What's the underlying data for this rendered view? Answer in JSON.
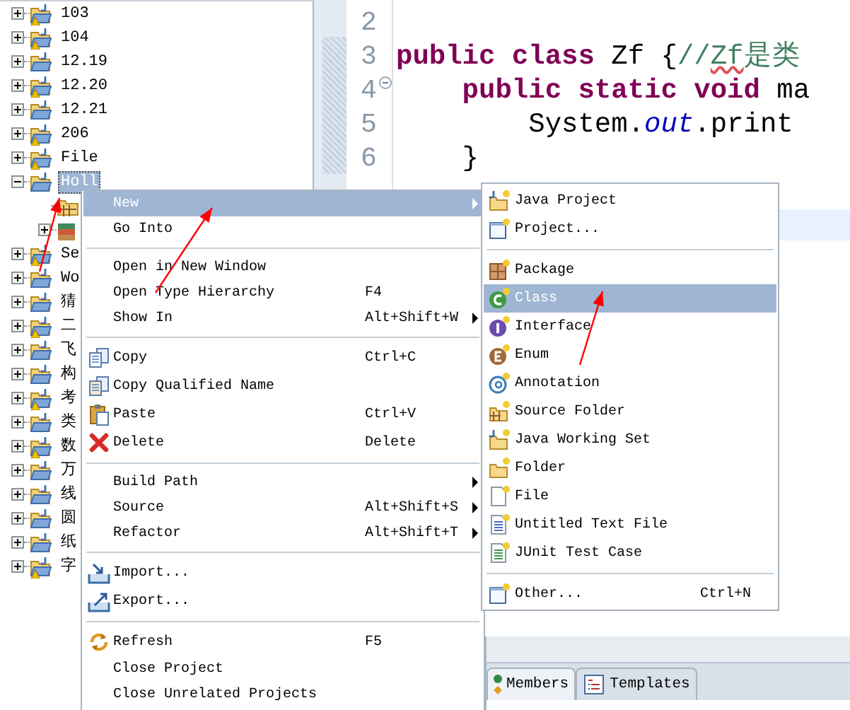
{
  "tree": [
    {
      "label": "103",
      "warning": true,
      "expanded": false,
      "selected": false
    },
    {
      "label": "104",
      "warning": true,
      "expanded": false,
      "selected": false
    },
    {
      "label": "12.19",
      "warning": false,
      "expanded": false,
      "selected": false
    },
    {
      "label": "12.20",
      "warning": true,
      "expanded": false,
      "selected": false
    },
    {
      "label": "12.21",
      "warning": false,
      "expanded": false,
      "selected": false
    },
    {
      "label": "206",
      "warning": true,
      "expanded": false,
      "selected": false
    },
    {
      "label": "File",
      "warning": true,
      "expanded": false,
      "selected": false
    },
    {
      "label": "Holl",
      "warning": false,
      "expanded": true,
      "selected": true,
      "children": [
        {
          "kind": "source-folder"
        },
        {
          "kind": "library",
          "expanded": false
        }
      ]
    },
    {
      "label": "Se",
      "warning": true,
      "expanded": false,
      "selected": false
    },
    {
      "label": "Wo",
      "warning": false,
      "expanded": false,
      "selected": false
    },
    {
      "label": "猜",
      "warning": false,
      "expanded": false,
      "selected": false
    },
    {
      "label": "二",
      "warning": true,
      "expanded": false,
      "selected": false
    },
    {
      "label": "飞",
      "warning": false,
      "expanded": false,
      "selected": false
    },
    {
      "label": "构",
      "warning": false,
      "expanded": false,
      "selected": false
    },
    {
      "label": "考",
      "warning": true,
      "expanded": false,
      "selected": false
    },
    {
      "label": "类",
      "warning": false,
      "expanded": false,
      "selected": false
    },
    {
      "label": "数",
      "warning": true,
      "expanded": false,
      "selected": false
    },
    {
      "label": "万",
      "warning": false,
      "expanded": false,
      "selected": false
    },
    {
      "label": "线",
      "warning": false,
      "expanded": false,
      "selected": false
    },
    {
      "label": "圆",
      "warning": false,
      "expanded": false,
      "selected": false
    },
    {
      "label": "纸",
      "warning": false,
      "expanded": false,
      "selected": false
    },
    {
      "label": "字",
      "warning": true,
      "expanded": false,
      "selected": false
    }
  ],
  "editor": {
    "lines": [
      {
        "number": "2",
        "fold": false
      },
      {
        "number": "3",
        "fold": false,
        "tokens": [
          {
            "kind": "keyword",
            "text": "public class"
          },
          {
            "kind": "plain",
            "text": " Zf {"
          },
          {
            "kind": "comment",
            "text": "//"
          },
          {
            "kind": "misspelled",
            "text": "Zf"
          },
          {
            "kind": "comment",
            "text": "是类"
          }
        ]
      },
      {
        "number": "4",
        "fold": true,
        "tokens": [
          {
            "kind": "keyword",
            "text": "    public static void"
          },
          {
            "kind": "plain",
            "text": " ma"
          }
        ]
      },
      {
        "number": "5",
        "fold": false,
        "tokens": [
          {
            "kind": "plain",
            "text": "        System."
          },
          {
            "kind": "field",
            "text": "out"
          },
          {
            "kind": "plain",
            "text": ".print"
          }
        ]
      },
      {
        "number": "6",
        "fold": false,
        "tokens": [
          {
            "kind": "plain",
            "text": "    }"
          }
        ]
      }
    ]
  },
  "context_menu": {
    "groups": [
      [
        {
          "label": "New",
          "submenu": true,
          "selected": true
        },
        {
          "label": "Go Into",
          "submenu": false,
          "selected": false
        }
      ],
      [
        {
          "label": "Open in New Window",
          "submenu": false,
          "selected": false
        },
        {
          "label": "Open Type Hierarchy",
          "shortcut": "F4",
          "submenu": false,
          "selected": false
        },
        {
          "label": "Show In",
          "shortcut": "Alt+Shift+W",
          "submenu": true,
          "selected": false
        }
      ],
      [
        {
          "kind": "copy",
          "label": "Copy",
          "shortcut": "Ctrl+C",
          "submenu": false,
          "selected": false
        },
        {
          "kind": "copy-qualified",
          "label": "Copy Qualified Name",
          "submenu": false,
          "selected": false
        },
        {
          "kind": "paste",
          "label": "Paste",
          "shortcut": "Ctrl+V",
          "submenu": false,
          "selected": false
        },
        {
          "kind": "delete",
          "label": "Delete",
          "shortcut": "Delete",
          "submenu": false,
          "selected": false
        }
      ],
      [
        {
          "label": "Build Path",
          "submenu": true,
          "selected": false
        },
        {
          "label": "Source",
          "shortcut": "Alt+Shift+S",
          "submenu": true,
          "selected": false
        },
        {
          "label": "Refactor",
          "shortcut": "Alt+Shift+T",
          "submenu": true,
          "selected": false
        }
      ],
      [
        {
          "kind": "import",
          "label": "Import...",
          "submenu": false,
          "selected": false
        },
        {
          "kind": "export",
          "label": "Export...",
          "submenu": false,
          "selected": false
        }
      ],
      [
        {
          "kind": "refresh",
          "label": "Refresh",
          "shortcut": "F5",
          "submenu": false,
          "selected": false
        },
        {
          "label": "Close Project",
          "submenu": false,
          "selected": false
        },
        {
          "label": "Close Unrelated Projects",
          "submenu": false,
          "selected": false
        }
      ]
    ]
  },
  "submenu": {
    "groups": [
      [
        {
          "kind": "java-project",
          "label": "Java Project",
          "submenu": false,
          "selected": false
        },
        {
          "kind": "project",
          "label": "Project...",
          "submenu": false,
          "selected": false
        }
      ],
      [
        {
          "kind": "package",
          "label": "Package",
          "submenu": false,
          "selected": false
        },
        {
          "kind": "class",
          "label": "Class",
          "submenu": false,
          "selected": true
        },
        {
          "kind": "interface",
          "label": "Interface",
          "submenu": false,
          "selected": false
        },
        {
          "kind": "enum",
          "label": "Enum",
          "submenu": false,
          "selected": false
        },
        {
          "kind": "annotation",
          "label": "Annotation",
          "submenu": false,
          "selected": false
        },
        {
          "kind": "source-folder",
          "label": "Source Folder",
          "submenu": false,
          "selected": false
        },
        {
          "kind": "working-set",
          "label": "Java Working Set",
          "submenu": false,
          "selected": false
        },
        {
          "kind": "folder",
          "label": "Folder",
          "submenu": false,
          "selected": false
        },
        {
          "kind": "file",
          "label": "File",
          "submenu": false,
          "selected": false
        },
        {
          "kind": "text-file",
          "label": "Untitled Text File",
          "submenu": false,
          "selected": false
        },
        {
          "kind": "junit",
          "label": "JUnit Test Case",
          "submenu": false,
          "selected": false
        }
      ],
      [
        {
          "kind": "other",
          "label": "Other...",
          "shortcut": "Ctrl+N",
          "submenu": false,
          "selected": false
        }
      ]
    ]
  },
  "bottom_tabs": [
    {
      "kind": "members",
      "label": "Members",
      "selected": true
    },
    {
      "kind": "templates",
      "label": "Templates",
      "selected": false
    }
  ]
}
